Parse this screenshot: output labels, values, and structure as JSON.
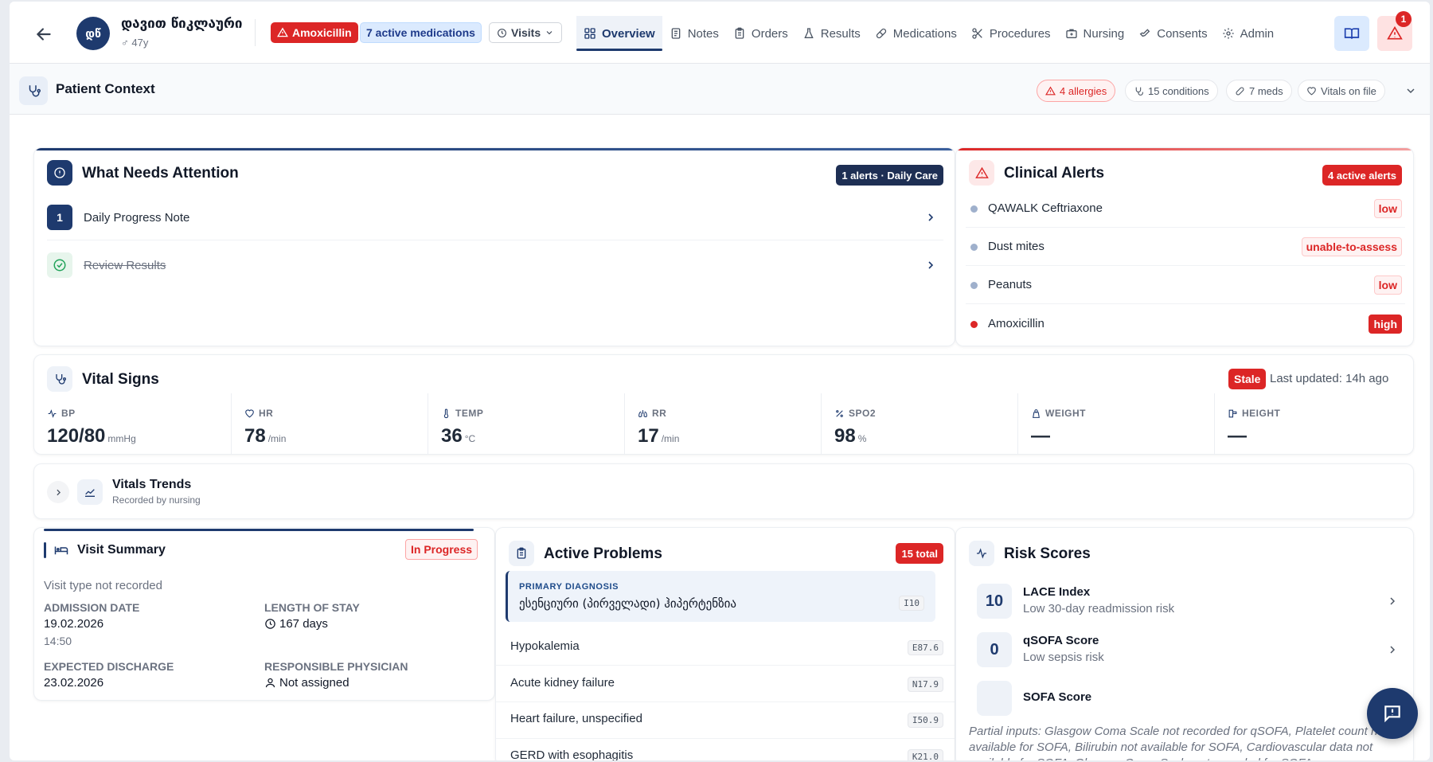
{
  "header": {
    "avatar_initials": "დწ",
    "patient_name": "დავით წიკლაური",
    "patient_age": "♂ 47y",
    "allergy_pill": "Amoxicillin",
    "meds_pill": "7 active medications",
    "visits_label": "Visits",
    "tabs": [
      {
        "label": "Overview",
        "icon": "overview-icon"
      },
      {
        "label": "Notes",
        "icon": "notes-icon"
      },
      {
        "label": "Orders",
        "icon": "orders-icon"
      },
      {
        "label": "Results",
        "icon": "flask-icon"
      },
      {
        "label": "Medications",
        "icon": "pill-icon"
      },
      {
        "label": "Procedures",
        "icon": "scissors-icon"
      },
      {
        "label": "Nursing",
        "icon": "nursing-icon"
      },
      {
        "label": "Consents",
        "icon": "consent-icon"
      },
      {
        "label": "Admin",
        "icon": "gear-icon"
      }
    ],
    "notification_count": "1"
  },
  "context": {
    "title": "Patient Context",
    "chips": {
      "allergies": "4 allergies",
      "conditions": "15 conditions",
      "meds": "7 meds",
      "vitals": "Vitals on file"
    }
  },
  "attention": {
    "title": "What Needs Attention",
    "badge": "1 alerts · Daily Care",
    "items": [
      {
        "num": "1",
        "label": "Daily Progress Note"
      },
      {
        "label": "Review Results"
      }
    ]
  },
  "alerts": {
    "title": "Clinical Alerts",
    "badge": "4 active alerts",
    "items": [
      {
        "name": "QAWALK Ceftriaxone",
        "severity": "low"
      },
      {
        "name": "Dust mites",
        "severity": "unable-to-assess"
      },
      {
        "name": "Peanuts",
        "severity": "low"
      },
      {
        "name": "Amoxicillin",
        "severity": "high"
      }
    ]
  },
  "vitals": {
    "title": "Vital Signs",
    "stale": "Stale",
    "last_updated": "Last updated: 14h ago",
    "items": [
      {
        "label": "BP",
        "value": "120/80",
        "unit": "mmHg"
      },
      {
        "label": "HR",
        "value": "78",
        "unit": "/min"
      },
      {
        "label": "TEMP",
        "value": "36",
        "unit": "°C"
      },
      {
        "label": "RR",
        "value": "17",
        "unit": "/min"
      },
      {
        "label": "SPO2",
        "value": "98",
        "unit": "%"
      },
      {
        "label": "WEIGHT",
        "value": "—",
        "unit": ""
      },
      {
        "label": "HEIGHT",
        "value": "—",
        "unit": ""
      }
    ]
  },
  "trends": {
    "title": "Vitals Trends",
    "subtitle": "Recorded by nursing"
  },
  "visit": {
    "title": "Visit Summary",
    "status": "In Progress",
    "type": "Visit type not recorded",
    "admission_label": "ADMISSION DATE",
    "admission_date": "19.02.2026",
    "admission_time": "14:50",
    "los_label": "LENGTH OF STAY",
    "los": "167 days",
    "discharge_label": "EXPECTED DISCHARGE",
    "discharge": "23.02.2026",
    "physician_label": "RESPONSIBLE PHYSICIAN",
    "physician": "Not assigned"
  },
  "problems": {
    "title": "Active Problems",
    "badge": "15 total",
    "primary_label": "PRIMARY DIAGNOSIS",
    "primary_name": "ესენციური (პირველადი) ჰიპერტენზია",
    "primary_code": "I10",
    "items": [
      {
        "name": "Hypokalemia",
        "code": "E87.6"
      },
      {
        "name": "Acute kidney failure",
        "code": "N17.9"
      },
      {
        "name": "Heart failure, unspecified",
        "code": "I50.9"
      },
      {
        "name": "GERD with esophagitis",
        "code": "K21.0"
      }
    ]
  },
  "risk": {
    "title": "Risk Scores",
    "items": [
      {
        "score": "10",
        "name": "LACE Index",
        "desc": "Low 30-day readmission risk"
      },
      {
        "score": "0",
        "name": "qSOFA Score",
        "desc": "Low sepsis risk"
      },
      {
        "score": "",
        "name": "SOFA Score",
        "desc": ""
      }
    ],
    "partial": "Partial inputs: Glasgow Coma Scale not recorded for qSOFA, Platelet count not available for SOFA, Bilirubin not available for SOFA, Cardiovascular data not available for SOFA, Glasgow Coma Scale not recorded for SOFA"
  },
  "colors": {
    "navy": "#1e3a6e",
    "danger": "#dc2626",
    "success": "#22a35a"
  }
}
